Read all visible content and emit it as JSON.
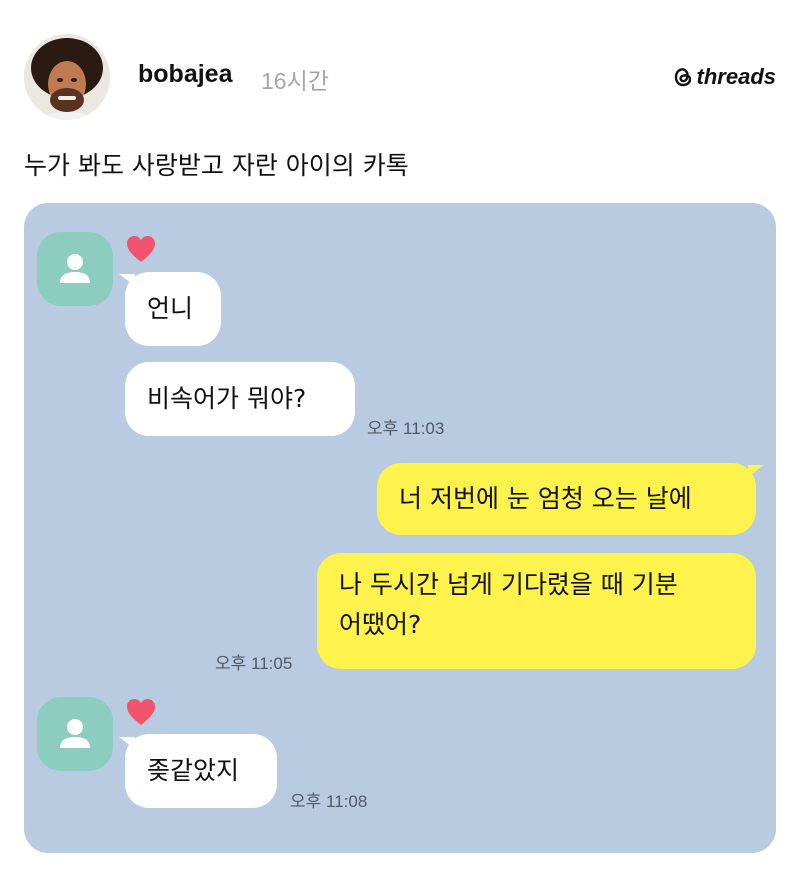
{
  "post": {
    "username": "bobajea",
    "time": "16시간",
    "brand": "threads",
    "caption": "누가 봐도 사랑받고 자란 아이의 카톡"
  },
  "chat": {
    "background": "#b9cbe0",
    "messages": [
      {
        "side": "incoming",
        "text": "언니"
      },
      {
        "side": "incoming",
        "text": "비속어가 뭐야?",
        "time": "오후 11:03"
      },
      {
        "side": "outgoing",
        "text": "너 저번에 눈 엄청 오는 날에"
      },
      {
        "side": "outgoing",
        "lines": [
          "나 두시간 넘게 기다렸을 때 기분",
          "어땠어?"
        ],
        "time": "오후 11:05"
      },
      {
        "side": "incoming",
        "text": "좆같았지",
        "time": "오후 11:08"
      }
    ]
  },
  "colors": {
    "incoming_bubble": "#ffffff",
    "outgoing_bubble": "#fef24c",
    "profile_placeholder": "#8ccdbf",
    "heart": "#f0546f"
  },
  "icons": {
    "avatar": "profile-photo",
    "brand": "threads-logo-icon",
    "profile": "default-person-icon",
    "reaction": "heart-icon"
  }
}
